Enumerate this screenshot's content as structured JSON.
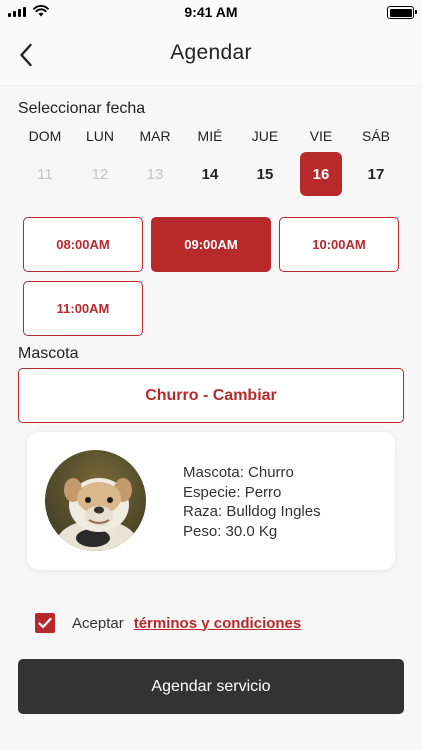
{
  "status_bar": {
    "time": "9:41 AM",
    "signal_icon": "cellular-signal-icon",
    "wifi_icon": "wifi-icon",
    "battery_icon": "battery-icon",
    "battery_level": 1.0
  },
  "nav": {
    "title": "Agendar",
    "back_icon": "chevron-left-icon"
  },
  "date_section": {
    "label": "Seleccionar fecha",
    "weekdays": [
      "DOM",
      "LUN",
      "MAR",
      "MIÉ",
      "JUE",
      "VIE",
      "SÁB"
    ],
    "days": [
      {
        "number": "11",
        "state": "disabled"
      },
      {
        "number": "12",
        "state": "disabled"
      },
      {
        "number": "13",
        "state": "disabled"
      },
      {
        "number": "14",
        "state": "available"
      },
      {
        "number": "15",
        "state": "available"
      },
      {
        "number": "16",
        "state": "selected"
      },
      {
        "number": "17",
        "state": "available"
      }
    ]
  },
  "time_slots": [
    {
      "label": "08:00AM",
      "selected": false
    },
    {
      "label": "09:00AM",
      "selected": true
    },
    {
      "label": "10:00AM",
      "selected": false
    },
    {
      "label": "11:00AM",
      "selected": false
    }
  ],
  "pet_section": {
    "label": "Mascota",
    "change_button": "Churro - Cambiar",
    "card": {
      "avatar_icon": "bulldog-photo",
      "name_line": "Mascota: Churro",
      "species_line": "Especie: Perro",
      "breed_line": "Raza: Bulldog Ingles",
      "weight_line": "Peso: 30.0 Kg"
    }
  },
  "terms": {
    "checked": true,
    "checkbox_icon": "checkmark-icon",
    "prefix": "Aceptar",
    "link": "términos y condiciones"
  },
  "submit_button": "Agendar servicio",
  "colors": {
    "accent": "#b8292b",
    "dark_button": "#333333",
    "background": "#f7f7f7"
  }
}
